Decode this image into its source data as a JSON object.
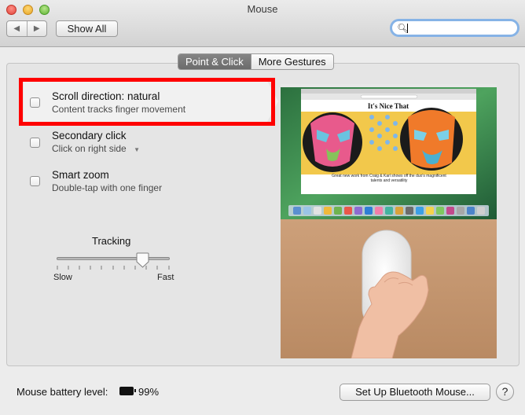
{
  "window": {
    "title": "Mouse"
  },
  "toolbar": {
    "back_glyph": "◀",
    "forward_glyph": "▶",
    "show_all_label": "Show All",
    "search": {
      "value": "",
      "placeholder": ""
    }
  },
  "tabs": [
    {
      "label": "Point & Click",
      "active": true
    },
    {
      "label": "More Gestures",
      "active": false
    }
  ],
  "options": [
    {
      "title": "Scroll direction: natural",
      "subtitle": "Content tracks finger movement",
      "checked": false,
      "selected": true
    },
    {
      "title": "Secondary click",
      "subtitle": "Click on right side",
      "checked": false,
      "has_dropdown": true
    },
    {
      "title": "Smart zoom",
      "subtitle": "Double-tap with one finger",
      "checked": false
    }
  ],
  "tracking": {
    "label": "Tracking",
    "min_label": "Slow",
    "max_label": "Fast",
    "level": 0.75
  },
  "preview": {
    "site_title": "It's Nice That",
    "caption": "Great new work from Craig & Karl shows off the duo's magnificent talents and versatility",
    "icons": [
      "magnifying-glass-icon",
      "hand-icon",
      "trackpad-gesture"
    ]
  },
  "footer": {
    "battery_label": "Mouse battery level:",
    "battery_value": "99%",
    "bluetooth_button": "Set Up Bluetooth Mouse...",
    "help_label": "?"
  },
  "colors": {
    "highlight": "#ff0000",
    "desktop_green": "#3f8d4f",
    "tab_active": "#787878",
    "focus_ring": "#86b3e6"
  }
}
